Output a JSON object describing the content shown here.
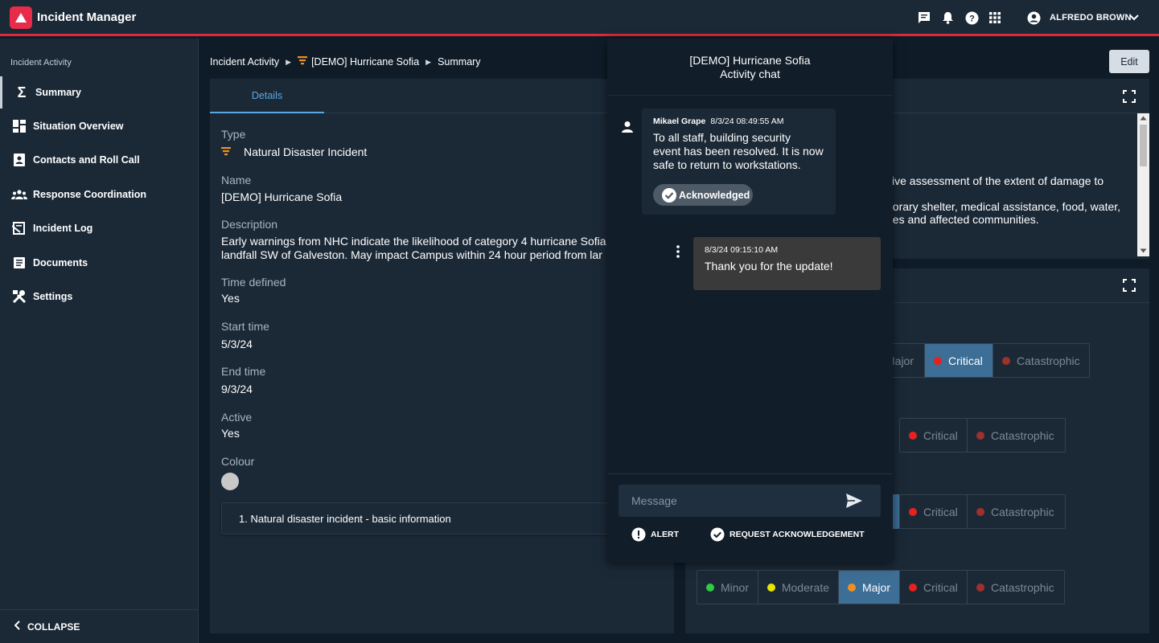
{
  "app": {
    "title": "Incident Manager"
  },
  "topbar": {
    "icons": [
      "chat-icon",
      "bell-icon",
      "help-icon",
      "apps-grid-icon",
      "account-icon",
      "chevron-down-icon"
    ],
    "user_name": "ALFREDO BROWN"
  },
  "sidebar": {
    "heading": "Incident Activity",
    "items": [
      {
        "label": "Summary",
        "icon": "sigma-icon",
        "active": true
      },
      {
        "label": "Situation Overview",
        "icon": "dashboard-icon"
      },
      {
        "label": "Contacts and Roll Call",
        "icon": "contacts-icon"
      },
      {
        "label": "Response Coordination",
        "icon": "group-icon"
      },
      {
        "label": "Incident Log",
        "icon": "log-icon"
      },
      {
        "label": "Documents",
        "icon": "document-icon"
      },
      {
        "label": "Settings",
        "icon": "tools-icon"
      }
    ],
    "collapse_label": "COLLAPSE"
  },
  "breadcrumb": {
    "items": [
      "Incident Activity",
      "[DEMO] Hurricane Sofia",
      "Summary"
    ]
  },
  "edit_label": "Edit",
  "details": {
    "tab": "Details",
    "type_label": "Type",
    "type_value": "Natural Disaster Incident",
    "name_label": "Name",
    "name_value": "[DEMO] Hurricane Sofia",
    "description_label": "Description",
    "description_line1": "Early warnings from NHC indicate the likelihood of category 4 hurricane Sofia",
    "description_line2": "landfall SW of Galveston. May impact Campus within 24 hour period from lar",
    "time_defined_label": "Time defined",
    "time_defined_value": "Yes",
    "start_time_label": "Start time",
    "start_time_value": "5/3/24",
    "end_time_label": "End time",
    "end_time_value": "9/3/24",
    "active_label": "Active",
    "active_value": "Yes",
    "colour_label": "Colour",
    "colour_value": "#c8c8c8",
    "section_title": "1. Natural disaster incident - basic information"
  },
  "right_top": {
    "line_colon": ":",
    "line1": "sive assessment of the extent of damage to",
    "line_dot": ".",
    "line2": "porary shelter, medical assistance, food, water,",
    "line3": "ees and affected communities."
  },
  "severity": {
    "colors": {
      "minor": "#2ecc40",
      "moderate": "#e6e600",
      "major": "#f0901e",
      "critical": "#e82020",
      "catastrophic": "#a0302c"
    },
    "rows": [
      {
        "labels": [
          "Major",
          "Critical",
          "Catastrophic"
        ],
        "selected": "Critical"
      },
      {
        "labels": [
          "Critical",
          "Catastrophic"
        ],
        "selected": ""
      },
      {
        "labels": [
          "Critical",
          "Catastrophic"
        ],
        "selected": ""
      },
      {
        "labels": [
          "Minor",
          "Moderate",
          "Major",
          "Critical",
          "Catastrophic"
        ],
        "selected": "Major"
      }
    ]
  },
  "chat": {
    "title": "[DEMO] Hurricane Sofia",
    "subtitle": "Activity chat",
    "messages": [
      {
        "author": "Mikael Grape",
        "timestamp": "8/3/24 08:49:55 AM",
        "lines": [
          "To all staff, building security",
          "event has been resolved. It is now",
          "safe to return to workstations."
        ],
        "badge": "Acknowledged"
      },
      {
        "author": "",
        "timestamp": "8/3/24 09:15:10 AM",
        "lines": [
          "Thank you for the update!"
        ]
      }
    ],
    "input_placeholder": "Message",
    "alert_label": "ALERT",
    "request_ack_label": "REQUEST ACKNOWLEDGEMENT"
  }
}
